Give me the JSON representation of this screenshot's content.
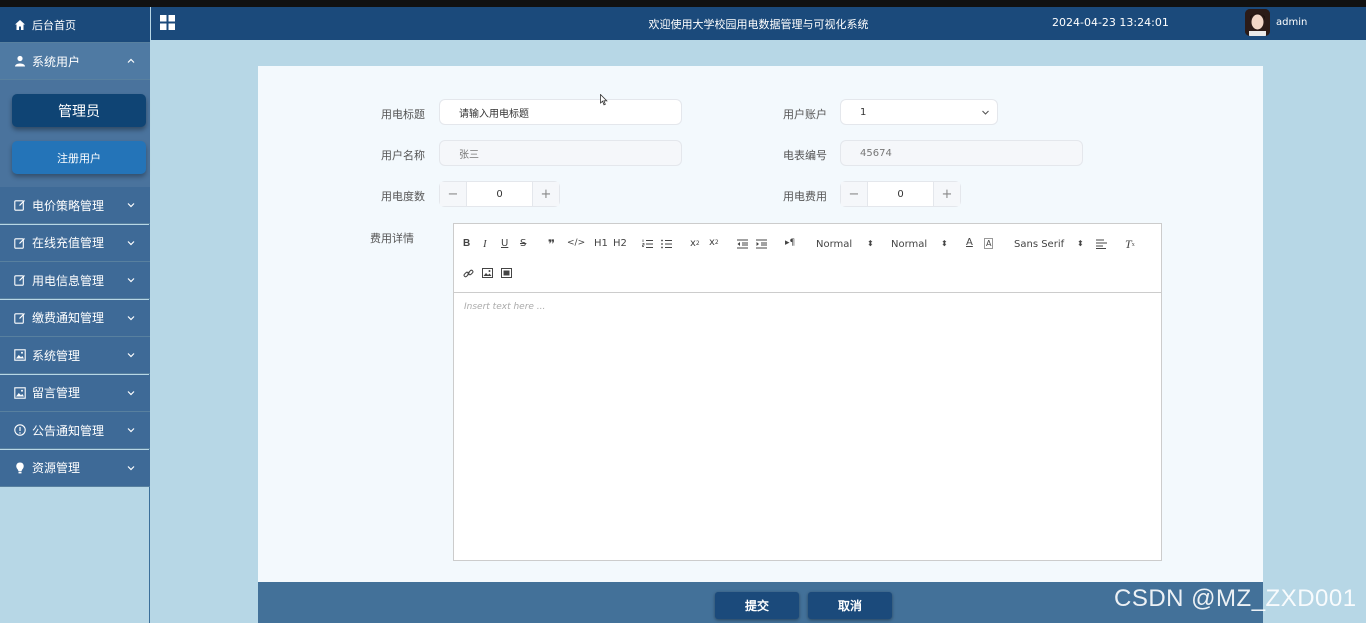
{
  "header": {
    "title": "欢迎使用大学校园用电数据管理与可视化系统",
    "datetime": "2024-04-23 13:24:01",
    "username": "admin"
  },
  "sidebar": {
    "home_label": "后台首页",
    "system_user_label": "系统用户",
    "admin_button": "管理员",
    "register_button": "注册用户",
    "items": [
      {
        "label": "电价策略管理",
        "icon": "edit-icon"
      },
      {
        "label": "在线充值管理",
        "icon": "edit-icon"
      },
      {
        "label": "用电信息管理",
        "icon": "edit-icon"
      },
      {
        "label": "缴费通知管理",
        "icon": "edit-icon"
      },
      {
        "label": "系统管理",
        "icon": "image-icon"
      },
      {
        "label": "留言管理",
        "icon": "image-icon"
      },
      {
        "label": "公告通知管理",
        "icon": "info-icon"
      },
      {
        "label": "资源管理",
        "icon": "bulb-icon"
      }
    ]
  },
  "form": {
    "title_label": "用电标题",
    "title_value": "请输入用电标题",
    "account_label": "用户账户",
    "account_value": "1",
    "username_label": "用户名称",
    "username_value": "张三",
    "meter_label": "电表编号",
    "meter_value": "45674",
    "usage_label": "用电度数",
    "usage_value": "0",
    "fee_label": "用电费用",
    "fee_value": "0",
    "detail_label": "费用详情"
  },
  "editor": {
    "toolbar": {
      "h1": "H1",
      "h2": "H2",
      "size_select": "Normal",
      "header_select": "Normal",
      "font_select": "Sans Serif"
    },
    "placeholder": "Insert text here ..."
  },
  "footer": {
    "submit": "提交",
    "cancel": "取消"
  },
  "watermark": "CSDN @MZ_ZXD001",
  "colors": {
    "sidebar": "#3e6a97",
    "header": "#1b4a7b",
    "background": "#b7d7e6",
    "footer": "#437199"
  }
}
